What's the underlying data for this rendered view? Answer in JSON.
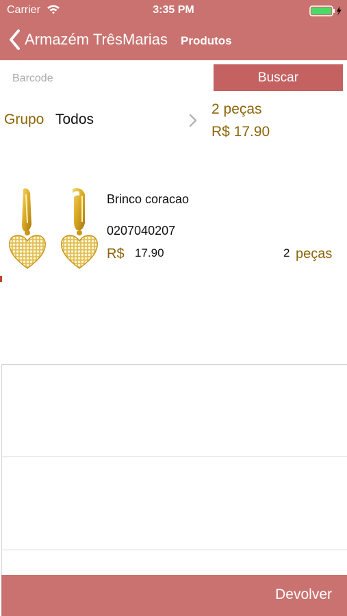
{
  "status": {
    "carrier": "Carrier",
    "time": "3:35 PM"
  },
  "nav": {
    "title": "Armazém TrêsMarias",
    "subtitle": "Produtos"
  },
  "search": {
    "placeholder": "Barcode",
    "value": "",
    "button_label": "Buscar"
  },
  "filter": {
    "label": "Grupo",
    "value": "Todos"
  },
  "summary": {
    "quantity": "2 peças",
    "total": "R$ 17.90"
  },
  "products": [
    {
      "name": "Brinco coracao",
      "code": "0207040207",
      "currency": "R$",
      "price": "17.90",
      "qty": "2",
      "qty_unit": "peças"
    }
  ],
  "footer": {
    "button_label": "Devolver"
  },
  "colors": {
    "bar": "#c9726f",
    "button": "#c46262",
    "accent_text": "#8b6508"
  }
}
